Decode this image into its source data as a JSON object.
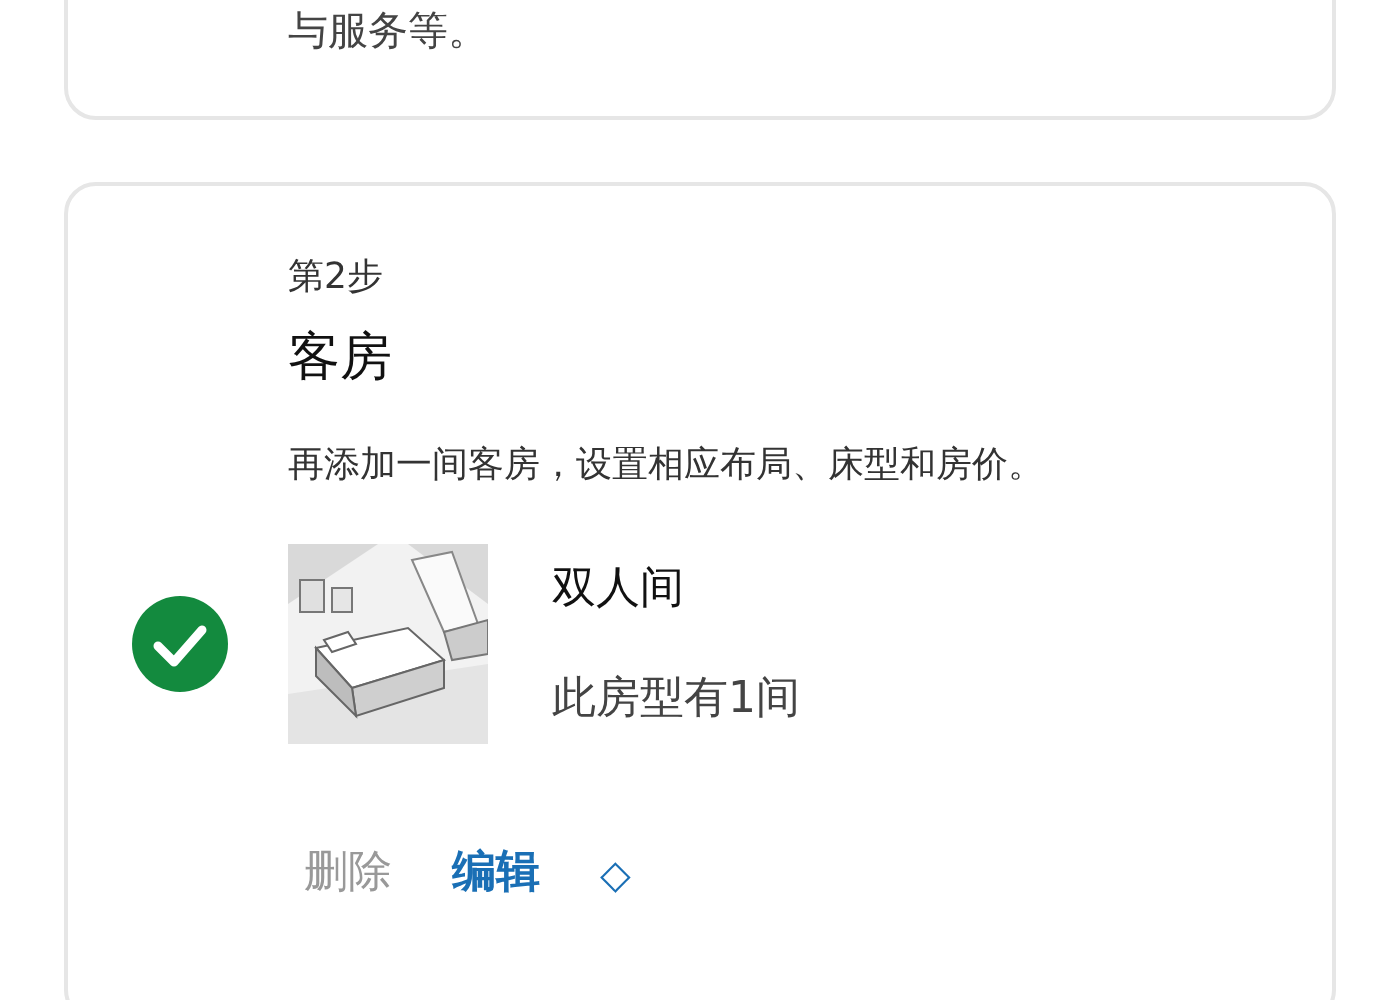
{
  "previous_step": {
    "description_tail": "与服务等。"
  },
  "step": {
    "label": "第2步",
    "title": "客房",
    "description": "再添加一间客房，设置相应布局、床型和房价。",
    "room": {
      "completed": true,
      "name": "双人间",
      "count": "此房型有1间"
    },
    "actions": [
      {
        "kind": "delete",
        "label": "删除",
        "disabled": true
      },
      {
        "kind": "edit",
        "label": "编辑",
        "disabled": false
      },
      {
        "kind": "toggle",
        "label": "◇",
        "disabled": false
      }
    ]
  }
}
